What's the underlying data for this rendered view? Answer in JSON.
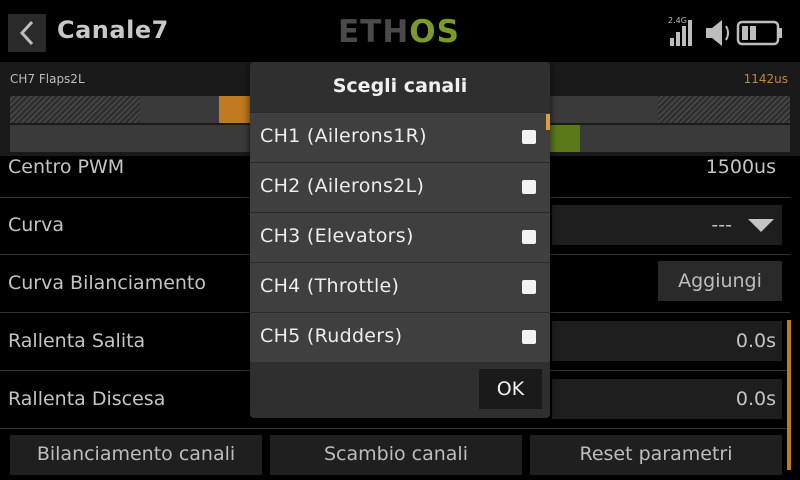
{
  "header": {
    "title": "Canale7",
    "logo_left": "ETH",
    "logo_right": "OS",
    "rf_label": "2.4G"
  },
  "channel_monitor": {
    "label": "CH7  Flaps2L",
    "value": "1142us"
  },
  "rows": {
    "pwm_center": {
      "label": "Centro PWM",
      "value": "1500us"
    },
    "curve": {
      "label": "Curva",
      "value": "---"
    },
    "balance_curve": {
      "label": "Curva Bilanciamento",
      "button": "Aggiungi"
    },
    "slow_up": {
      "label": "Rallenta Salita",
      "value": "0.0s"
    },
    "slow_down": {
      "label": "Rallenta Discesa",
      "value": "0.0s"
    }
  },
  "bottom_buttons": {
    "balance": "Bilanciamento canali",
    "swap": "Scambio canali",
    "reset": "Reset parametri"
  },
  "dialog": {
    "title": "Scegli canali",
    "items": [
      {
        "label": "CH1 (Ailerons1R)",
        "checked": false
      },
      {
        "label": "CH2 (Ailerons2L)",
        "checked": false
      },
      {
        "label": "CH3 (Elevators)",
        "checked": false
      },
      {
        "label": "CH4 (Throttle)",
        "checked": false
      },
      {
        "label": "CH5 (Rudders)",
        "checked": false
      }
    ],
    "ok_label": "OK"
  },
  "colors": {
    "accent_orange": "#c07a20",
    "accent_green": "#7a9a2a"
  }
}
